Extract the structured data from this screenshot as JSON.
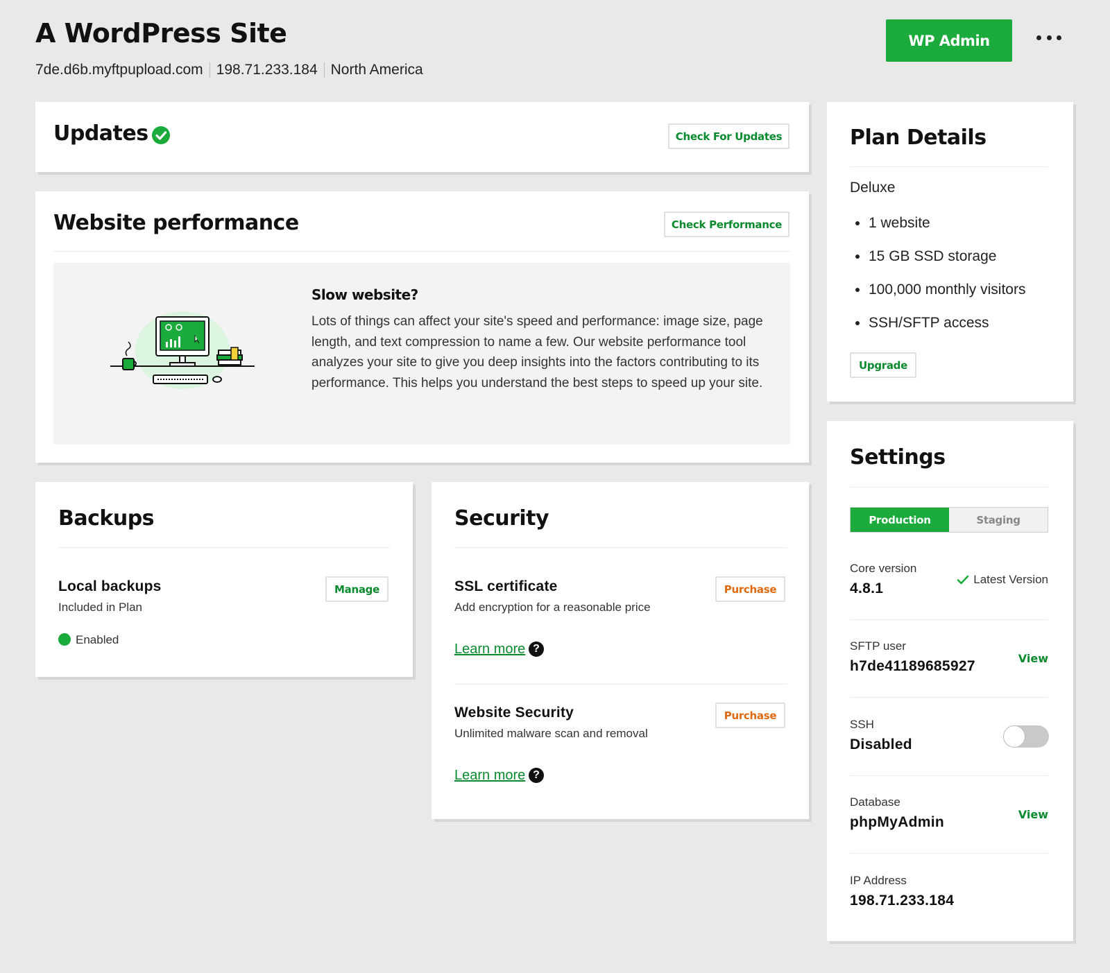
{
  "header": {
    "title": "A WordPress Site",
    "domain": "7de.d6b.myftpupload.com",
    "ip": "198.71.233.184",
    "region": "North America",
    "wp_admin_label": "WP Admin"
  },
  "updates": {
    "title": "Updates",
    "check_label": "Check For Updates"
  },
  "performance": {
    "title": "Website performance",
    "check_label": "Check Performance",
    "question": "Slow website?",
    "body": "Lots of things can affect your site's speed and performance: image size, page length, and text compression to name a few. Our website performance tool analyzes your site to give you deep insights into the factors contributing to its performance. This helps you understand the best steps to speed up your site."
  },
  "backups": {
    "title": "Backups",
    "item_title": "Local backups",
    "item_sub": "Included in Plan",
    "manage_label": "Manage",
    "status": "Enabled"
  },
  "security": {
    "title": "Security",
    "items": [
      {
        "title": "SSL certificate",
        "sub": "Add encryption for a reasonable price",
        "button": "Purchase",
        "link": "Learn more"
      },
      {
        "title": "Website Security",
        "sub": "Unlimited malware scan and removal",
        "button": "Purchase",
        "link": "Learn more"
      }
    ]
  },
  "plan": {
    "title": "Plan Details",
    "name": "Deluxe",
    "features": [
      "1 website",
      "15 GB SSD storage",
      "100,000 monthly visitors",
      "SSH/SFTP access"
    ],
    "upgrade_label": "Upgrade"
  },
  "settings": {
    "title": "Settings",
    "tabs": [
      "Production",
      "Staging"
    ],
    "active_tab": "Production",
    "core_label": "Core version",
    "core_value": "4.8.1",
    "core_status": "Latest Version",
    "sftp_label": "SFTP user",
    "sftp_value": "h7de41189685927",
    "sftp_action": "View",
    "ssh_label": "SSH",
    "ssh_value": "Disabled",
    "ssh_enabled": false,
    "db_label": "Database",
    "db_value": "phpMyAdmin",
    "db_action": "View",
    "ip_label": "IP Address",
    "ip_value": "198.71.233.184"
  },
  "colors": {
    "brand_green": "#1bab3c",
    "link_green": "#0a8a2f",
    "purchase_orange": "#e06a10",
    "background": "#e9e9e9"
  }
}
